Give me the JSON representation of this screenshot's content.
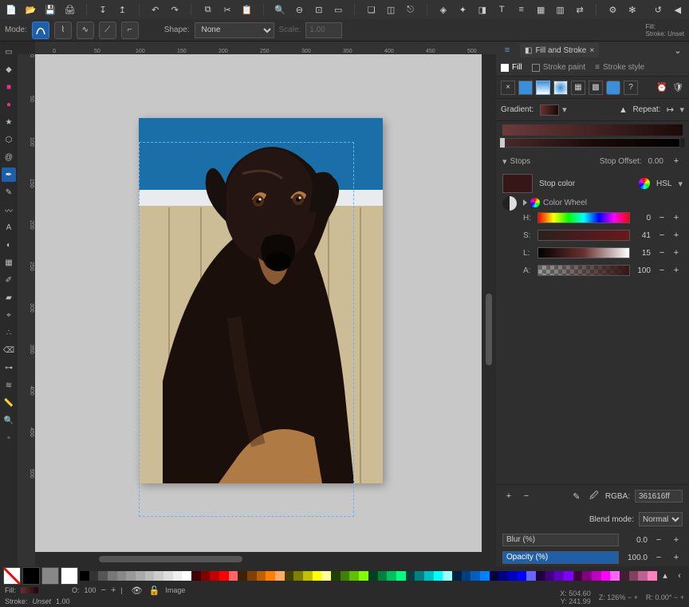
{
  "fillStroke": {
    "tabTitle": "Fill and Stroke",
    "subtabs": {
      "fill": "Fill",
      "strokePaint": "Stroke paint",
      "strokeStyle": "Stroke style"
    },
    "gradientLabel": "Gradient:",
    "repeatLabel": "Repeat:",
    "stopsLabel": "Stops",
    "stopOffsetLabel": "Stop Offset:",
    "stopOffsetValue": "0.00",
    "stopColorLabel": "Stop color",
    "colorMode": "HSL",
    "colorWheel": "Color Wheel",
    "h": {
      "label": "H:",
      "value": "0"
    },
    "s": {
      "label": "S:",
      "value": "41"
    },
    "l": {
      "label": "L:",
      "value": "15"
    },
    "a": {
      "label": "A:",
      "value": "100"
    },
    "rgbaLabel": "RGBA:",
    "rgbaValue": "361616ff",
    "blendLabel": "Blend mode:",
    "blendValue": "Normal",
    "blurLabel": "Blur (%)",
    "blurValue": "0.0",
    "opacityLabel": "Opacity (%)",
    "opacityValue": "100.0"
  },
  "optionsBar": {
    "modeLabel": "Mode:",
    "shapeLabel": "Shape:",
    "shapeValue": "None",
    "scaleLabel": "Scale:",
    "scaleValue": "1.00",
    "fillLabel": "Fill:",
    "strokeLabel": "Stroke:",
    "strokeValue": "Unset"
  },
  "status": {
    "fillLabel": "Fill:",
    "strokeLabel": "Stroke:",
    "strokeVal": "Unset",
    "strokeW": "1.00",
    "opacityLabel": "O:",
    "opacity": "100",
    "layerLabel": "Image",
    "x": "X:",
    "xv": "504.60",
    "y": "Y:",
    "yv": "241.99",
    "z": "Z:",
    "zv": "126%",
    "r": "R:",
    "rv": "0.00°"
  },
  "ruler": {
    "marks": [
      "0",
      "50",
      "100",
      "150",
      "200",
      "250",
      "300",
      "350",
      "400",
      "450",
      "500"
    ]
  },
  "palette": [
    "#000",
    "#333",
    "#555",
    "#777",
    "#888",
    "#999",
    "#aaa",
    "#bbb",
    "#ccc",
    "#ddd",
    "#eee",
    "#fff",
    "#400000",
    "#800000",
    "#c00000",
    "#ff0000",
    "#ff6666",
    "#402000",
    "#804000",
    "#c06000",
    "#ff8000",
    "#ffaa66",
    "#404000",
    "#808000",
    "#c0c000",
    "#ffff00",
    "#ffff99",
    "#204000",
    "#408000",
    "#60c000",
    "#80ff00",
    "#004020",
    "#008040",
    "#00c060",
    "#00ff80",
    "#004040",
    "#008080",
    "#00c0c0",
    "#00ffff",
    "#99ffff",
    "#002040",
    "#004080",
    "#0060c0",
    "#0080ff",
    "#000040",
    "#000080",
    "#0000c0",
    "#0000ff",
    "#6666ff",
    "#200040",
    "#400080",
    "#6000c0",
    "#8000ff",
    "#400040",
    "#800080",
    "#c000c0",
    "#ff00ff",
    "#ff66ff",
    "#402030",
    "#804060",
    "#c06090",
    "#ff80c0"
  ]
}
